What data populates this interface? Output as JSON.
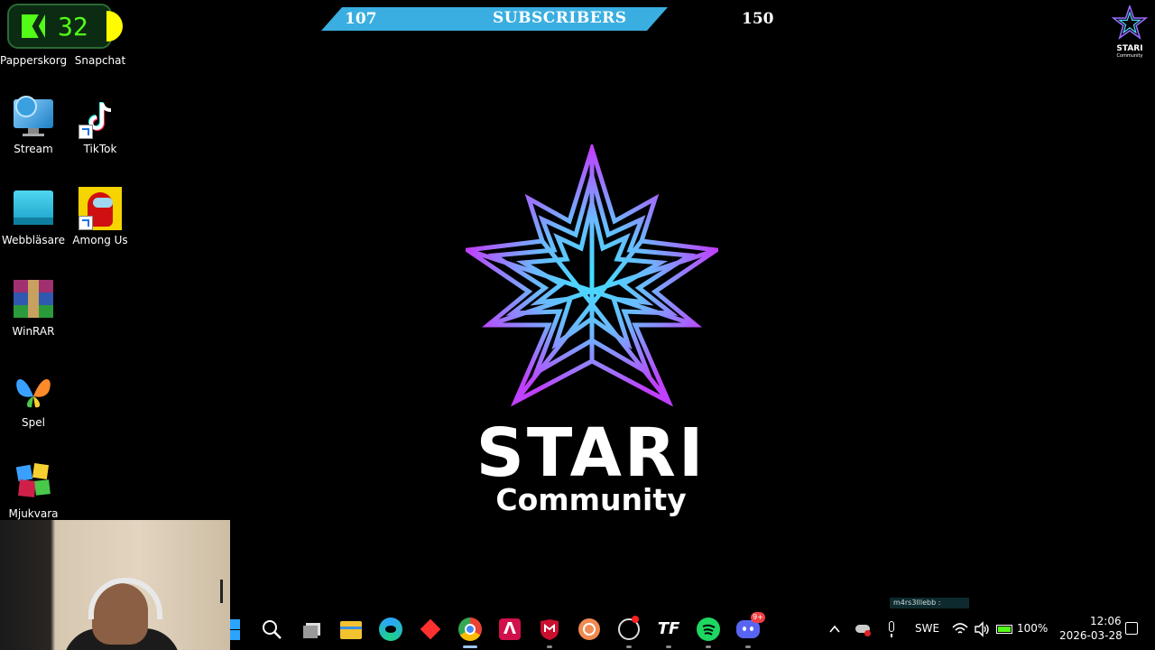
{
  "overlay": {
    "kick_count": "32",
    "subscribers_current": "107",
    "subscribers_label": "SUBSCRIBERS",
    "subscribers_goal": "150",
    "mini_logo_title": "STARI",
    "mini_logo_subtitle": "Community"
  },
  "desktop_icons": [
    {
      "label": "Papperskorg",
      "icon": "recycle-bin-icon"
    },
    {
      "label": "Snapchat",
      "icon": "snapchat-icon"
    },
    {
      "label": "Stream",
      "icon": "monitor-globe-icon"
    },
    {
      "label": "TikTok",
      "icon": "tiktok-icon"
    },
    {
      "label": "Webbläsare",
      "icon": "browser-folder-icon"
    },
    {
      "label": "Among Us",
      "icon": "among-us-icon"
    },
    {
      "label": "WinRAR",
      "icon": "winrar-icon"
    },
    {
      "label": "Spel",
      "icon": "butterfly-icon"
    },
    {
      "label": "Mjukvara",
      "icon": "software-cubes-icon"
    }
  ],
  "main_logo": {
    "title": "STARI",
    "subtitle": "Community",
    "colors": {
      "outer": "#b040ff",
      "inner": "#40e0ff"
    }
  },
  "taskbar": {
    "apps": [
      "start-icon",
      "search-icon",
      "task-view-icon",
      "file-explorer-icon",
      "edge-icon",
      "app-red-diamond-icon",
      "chrome-icon",
      "app-a-icon",
      "mcafee-icon",
      "app-spiral-icon",
      "obs-icon",
      "tf-icon",
      "spotify-icon",
      "discord-icon"
    ],
    "discord_badge": "9+",
    "language": "SWE",
    "battery": "100%",
    "time": "12:06",
    "date": "2026-03-28",
    "notification_text": "m4rs3lllebb :"
  }
}
